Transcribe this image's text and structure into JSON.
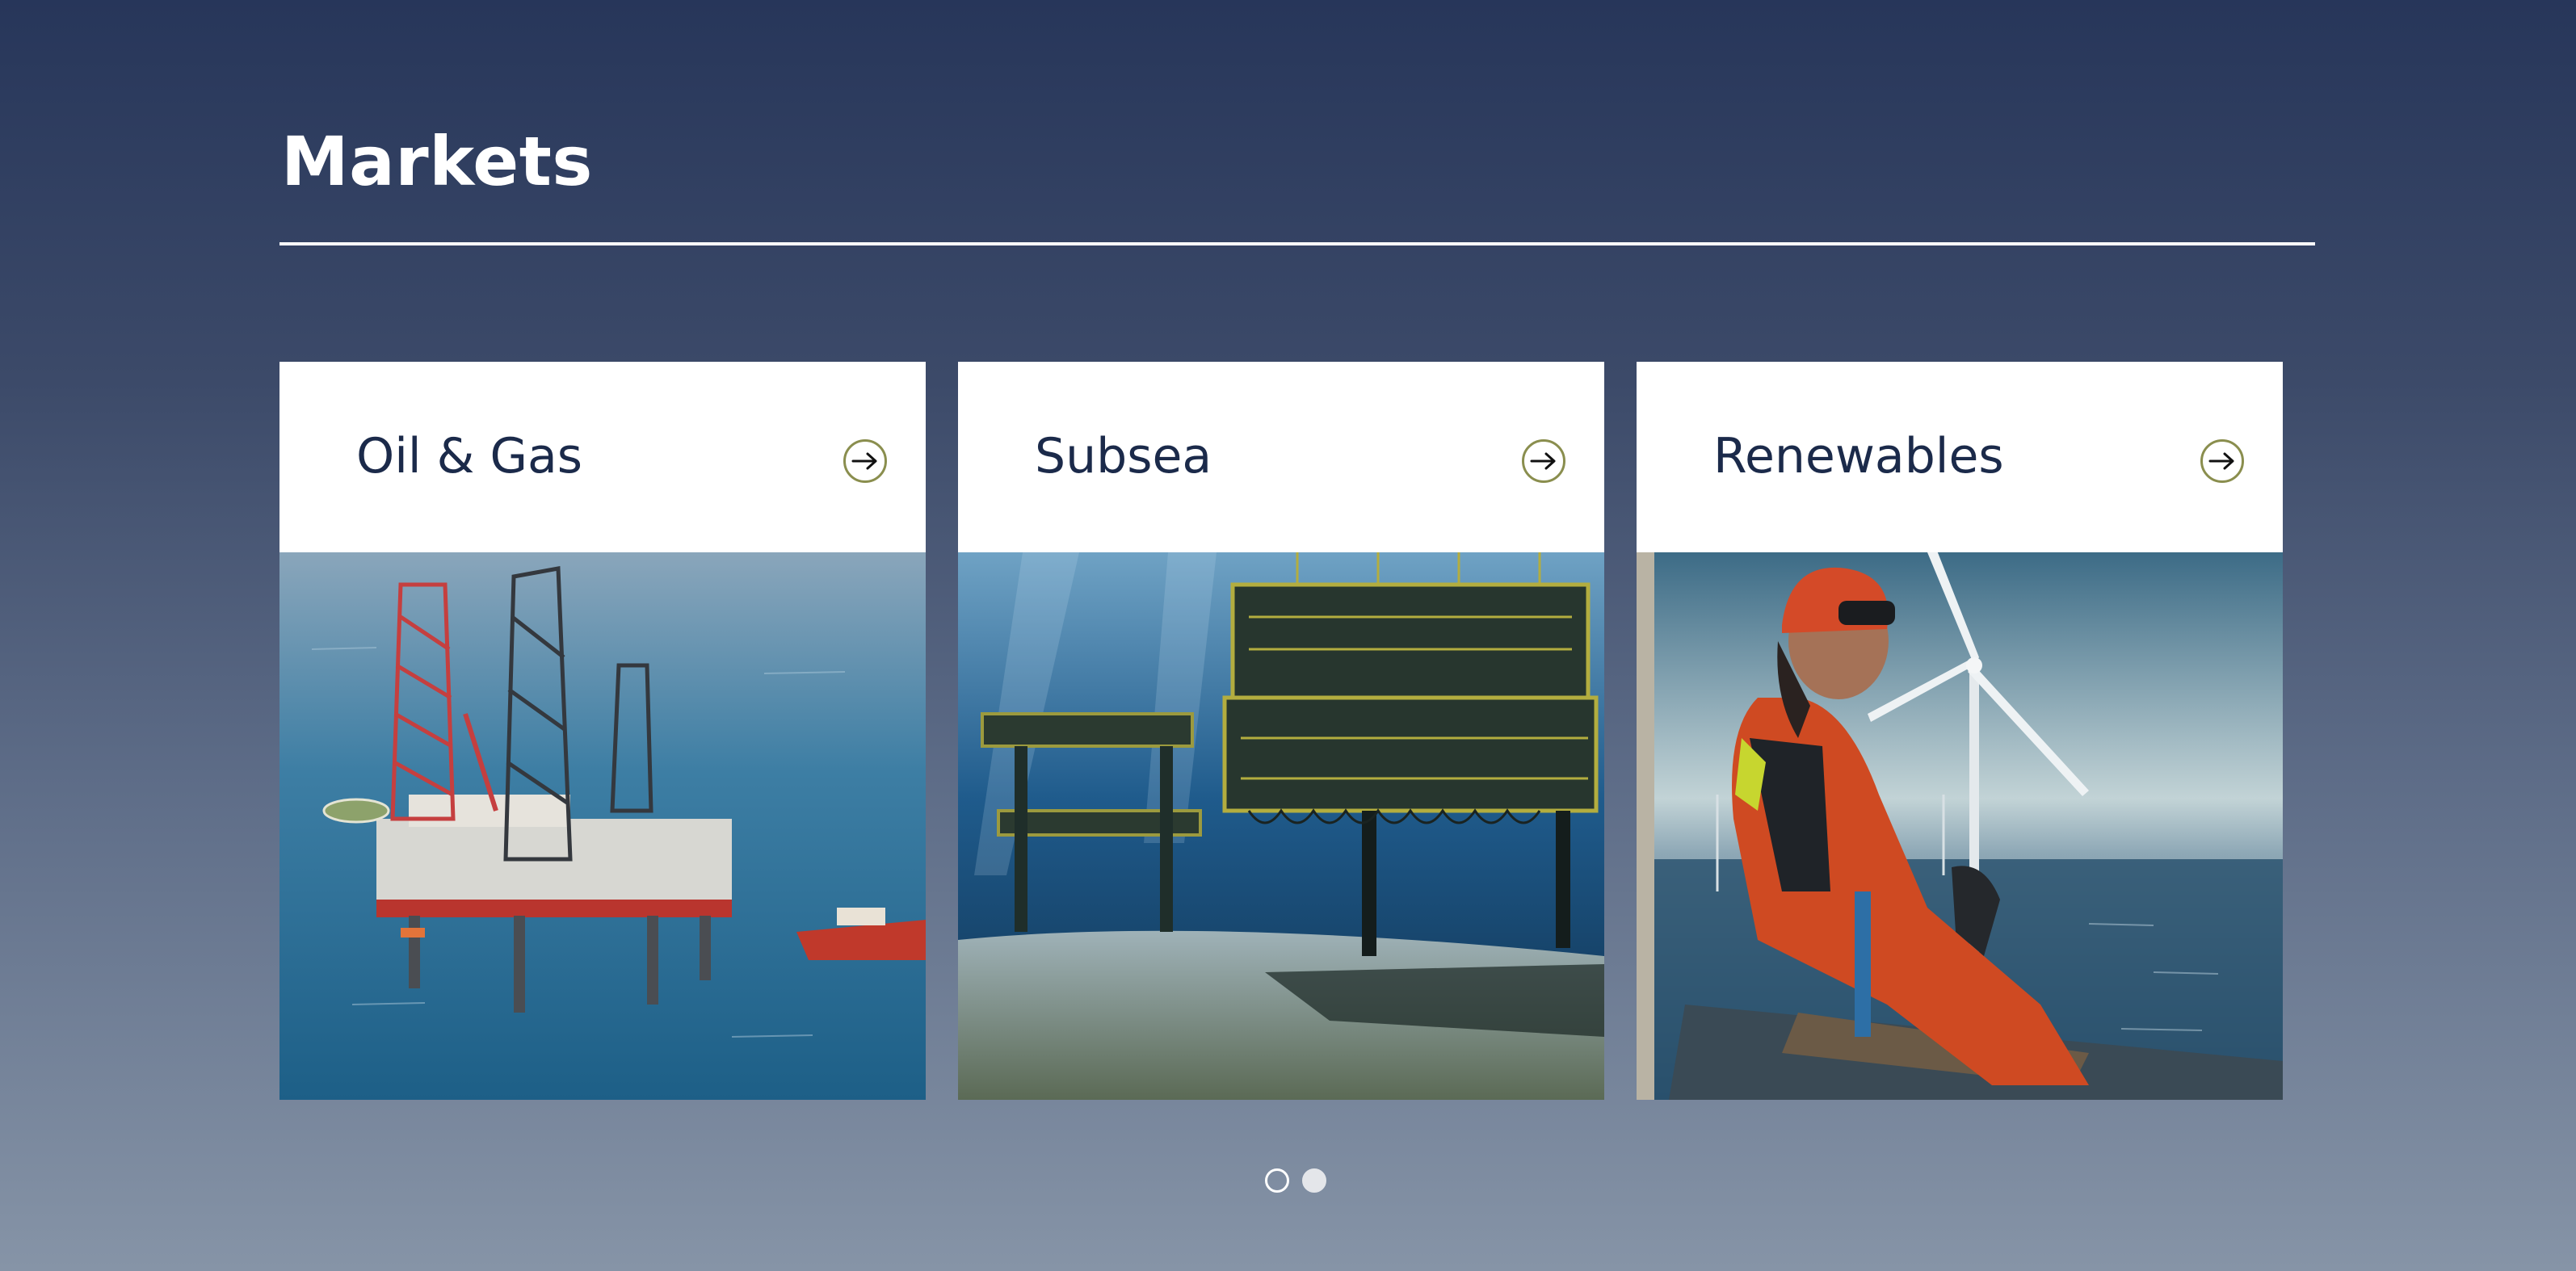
{
  "section": {
    "title": "Markets"
  },
  "cards": [
    {
      "label": "Oil & Gas",
      "image": "offshore-oil-rig-photo",
      "icon": "arrow-right-icon"
    },
    {
      "label": "Subsea",
      "image": "subsea-structure-photo",
      "icon": "arrow-right-icon"
    },
    {
      "label": "Renewables",
      "image": "wind-technician-photo",
      "icon": "arrow-right-icon"
    }
  ],
  "carousel": {
    "page_count": 2,
    "active_index": 1
  },
  "colors": {
    "background_top": "#27365a",
    "background_bottom": "#8694a7",
    "card_text": "#1b2a4a",
    "arrow_ring": "#8a8e4e",
    "card_background": "#ffffff"
  }
}
